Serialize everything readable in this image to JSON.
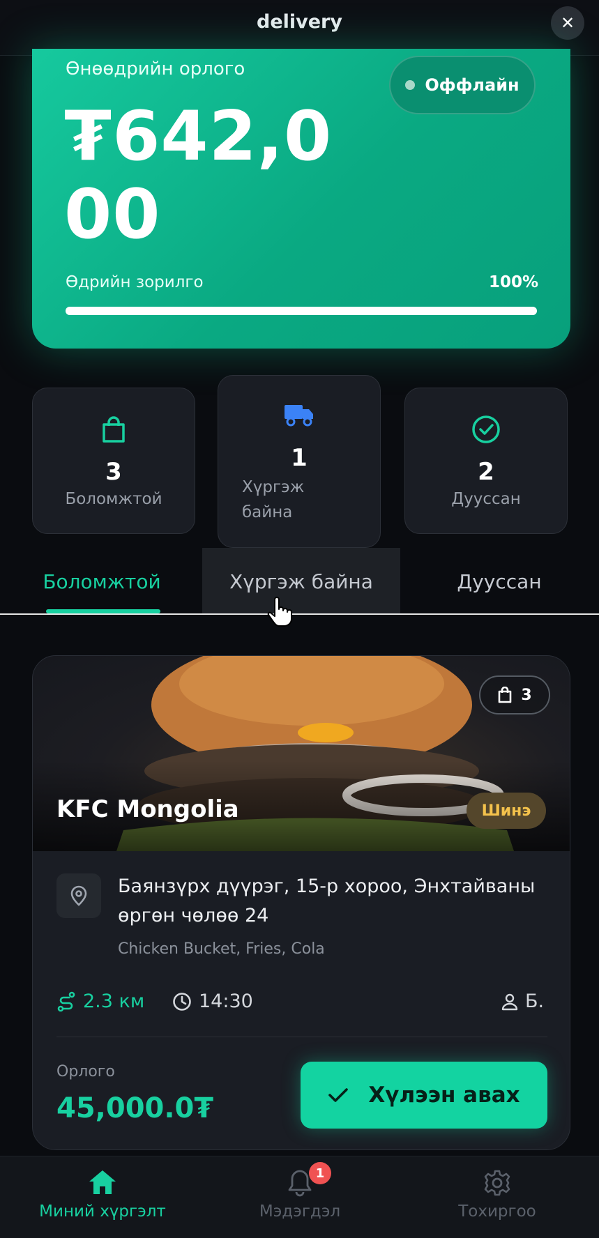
{
  "header": {
    "title": "delivery",
    "close_symbol": "✕"
  },
  "earnings": {
    "label": "Өнөөдрийн орлого",
    "amount": "₮642,000",
    "status": "Оффлайн",
    "goal_label": "Өдрийн зорилго",
    "goal_percent_text": "100%",
    "goal_progress": 1.0
  },
  "stats": [
    {
      "icon": "shopping-bag-icon",
      "value": "3",
      "label": "Боломжтой"
    },
    {
      "icon": "truck-icon",
      "value": "1",
      "label": "Хүргэж байна"
    },
    {
      "icon": "check-circle-icon",
      "value": "2",
      "label": "Дууссан"
    }
  ],
  "tabs": [
    {
      "label": "Боломжтой",
      "active": true
    },
    {
      "label": "Хүргэж байна",
      "active": false
    },
    {
      "label": "Дууссан",
      "active": false
    }
  ],
  "order": {
    "restaurant": "KFC Mongolia",
    "badge": "Шинэ",
    "item_count": "3",
    "address": "Баянзүрх дүүрэг, 15-р хороо, Энхтайваны өргөн чөлөө 24",
    "items": "Chicken Bucket, Fries, Cola",
    "distance": "2.3 км",
    "time": "14:30",
    "customer": "Б.",
    "earning_label": "Орлого",
    "earning_amount": "45,000.0₮",
    "accept_label": "Хүлээн авах"
  },
  "nav": [
    {
      "icon": "home-icon",
      "label": "Миний хүргэлт",
      "active": true
    },
    {
      "icon": "bell-icon",
      "label": "Мэдэгдэл",
      "badge": "1"
    },
    {
      "icon": "gear-icon",
      "label": "Тохиргоо"
    }
  ],
  "colors": {
    "accent": "#18d0a0",
    "card": "#1a1d24",
    "background": "#0a0c10",
    "badge_new": "#f4c24c",
    "notification": "#f05252"
  }
}
